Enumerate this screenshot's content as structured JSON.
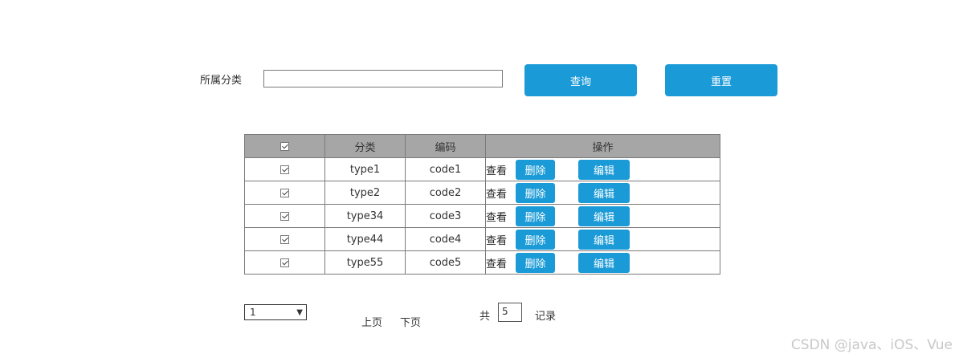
{
  "search": {
    "label": "所属分类",
    "value": "",
    "query_button": "查询",
    "reset_button": "重置"
  },
  "table": {
    "columns": [
      "",
      "分类",
      "编码",
      "操作"
    ],
    "rows": [
      {
        "checked": true,
        "category": "type1",
        "code": "code1"
      },
      {
        "checked": true,
        "category": "type2",
        "code": "code2"
      },
      {
        "checked": true,
        "category": "type34",
        "code": "code3"
      },
      {
        "checked": true,
        "category": "type44",
        "code": "code4"
      },
      {
        "checked": true,
        "category": "type55",
        "code": "code5"
      }
    ],
    "actions": {
      "view": "查看",
      "delete": "删除",
      "edit": "编辑"
    }
  },
  "pagination": {
    "page_selected": "1",
    "prev": "上页",
    "next": "下页",
    "total_prefix": "共",
    "total_value": "5",
    "total_suffix": "记录"
  },
  "watermark": "CSDN @java、iOS、Vue",
  "colors": {
    "accent": "#1a9ad6",
    "header_bg": "#a6a6a6",
    "border": "#7a7a7a"
  }
}
